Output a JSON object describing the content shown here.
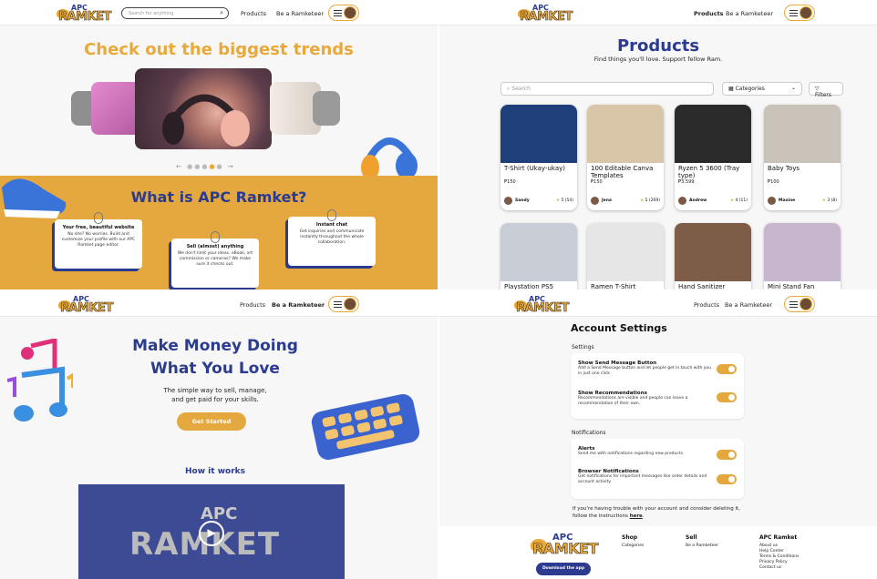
{
  "p1": {
    "logo_apc": "APC",
    "logo_ramket": "RAMKET",
    "search_placeholder": "Search for anything",
    "nav_products": "Products",
    "nav_ramketeer": "Be a Ramketeer",
    "hero_title": "Check out the biggest trends",
    "carousel_prev": "←",
    "carousel_next": "→",
    "band_title": "What is APC Ramket?",
    "cards": [
      {
        "title": "Your free, beautiful website",
        "body": "No site? No worries. Build and customize your profile with our APC Ramket page editor."
      },
      {
        "title": "Sell (almost) anything",
        "body": "We don't limit your ideas. eBook, art commission or cameras? We make sure it checks out."
      },
      {
        "title": "Instant chat",
        "body": "Get inquiries and communicate instantly throughout the whole collaboration."
      }
    ]
  },
  "p2": {
    "logo_apc": "APC",
    "logo_ramket": "RAMKET",
    "nav_products": "Products",
    "nav_ramketeer": "Be a Ramketeer",
    "title": "Products",
    "subtitle": "Find things you'll love. Support fellow Ram.",
    "search_placeholder": "Search",
    "categories_label": "Categories",
    "filters_label": "Filters",
    "products": [
      {
        "name": "T-Shirt (Ukay-ukay)",
        "price": "₱150",
        "seller": "Sandy",
        "rating": "5",
        "count": "(54)",
        "color": "#1f3f7a"
      },
      {
        "name": "100 Editable Canva Templates",
        "price": "₱150",
        "seller": "Jena",
        "rating": "5",
        "count": "(269)",
        "color": "#d9c6a8"
      },
      {
        "name": "Ryzen 5 3600 (Tray type)",
        "price": "₱3,599",
        "seller": "Andrew",
        "rating": "4",
        "count": "(11)",
        "color": "#2a2a2a"
      },
      {
        "name": "Baby Toys",
        "price": "₱100",
        "seller": "Maxine",
        "rating": "3",
        "count": "(8)",
        "color": "#c9c2b8"
      },
      {
        "name": "Playstation PS5",
        "price": "",
        "seller": "",
        "rating": "",
        "count": "",
        "color": "#c8ccd4"
      },
      {
        "name": "Ramen T-Shirt",
        "price": "",
        "seller": "",
        "rating": "",
        "count": "",
        "color": "#e6e6e6"
      },
      {
        "name": "Hand Sanitizer",
        "price": "",
        "seller": "",
        "rating": "",
        "count": "",
        "color": "#7d5c48"
      },
      {
        "name": "Mini Stand Fan",
        "price": "",
        "seller": "",
        "rating": "",
        "count": "",
        "color": "#c8b6cf"
      }
    ]
  },
  "p3": {
    "logo_apc": "APC",
    "logo_ramket": "RAMKET",
    "nav_products": "Products",
    "nav_ramketeer": "Be a Ramketeer",
    "headline_1": "Make Money Doing",
    "headline_2": "What You Love",
    "sub_1": "The simple way to sell, manage,",
    "sub_2": "and get paid for your skills.",
    "cta": "Get Started",
    "how": "How it works",
    "video_apc": "APC",
    "video_ramket": "RAMKET"
  },
  "p4": {
    "logo_apc": "APC",
    "logo_ramket": "RAMKET",
    "nav_products": "Products",
    "nav_ramketeer": "Be a Ramketeer",
    "title": "Account Settings",
    "settings_label": "Settings",
    "notifications_label": "Notifications",
    "settings": [
      {
        "title": "Show Send Message Button",
        "desc": "Add a Send Message button and let people get in touch with you in just one click"
      },
      {
        "title": "Show Recommendations",
        "desc": "Recommendations are visible and people can leave a recommendation of their own."
      }
    ],
    "notifications": [
      {
        "title": "Alerts",
        "desc": "Send me with notifications regarding new products."
      },
      {
        "title": "Browser Notifications",
        "desc": "Get notifications for important messages like order details and account activity."
      }
    ],
    "delete_note_1": "If you're having trouble with your account and consider deleting it,",
    "delete_note_2": "follow the instructions",
    "delete_link": "here",
    "footer": {
      "shop": "Shop",
      "shop_items": [
        "Categories"
      ],
      "sell": "Sell",
      "sell_items": [
        "Be a Ramketeer"
      ],
      "apc": "APC Ramket",
      "apc_items": [
        "About us",
        "Help Center",
        "Terms & Conditions",
        "Privacy Policy",
        "Contact us"
      ],
      "download": "Download the app"
    }
  },
  "colors": {
    "gold": "#e5a83f",
    "navy": "#2b3b8f"
  }
}
